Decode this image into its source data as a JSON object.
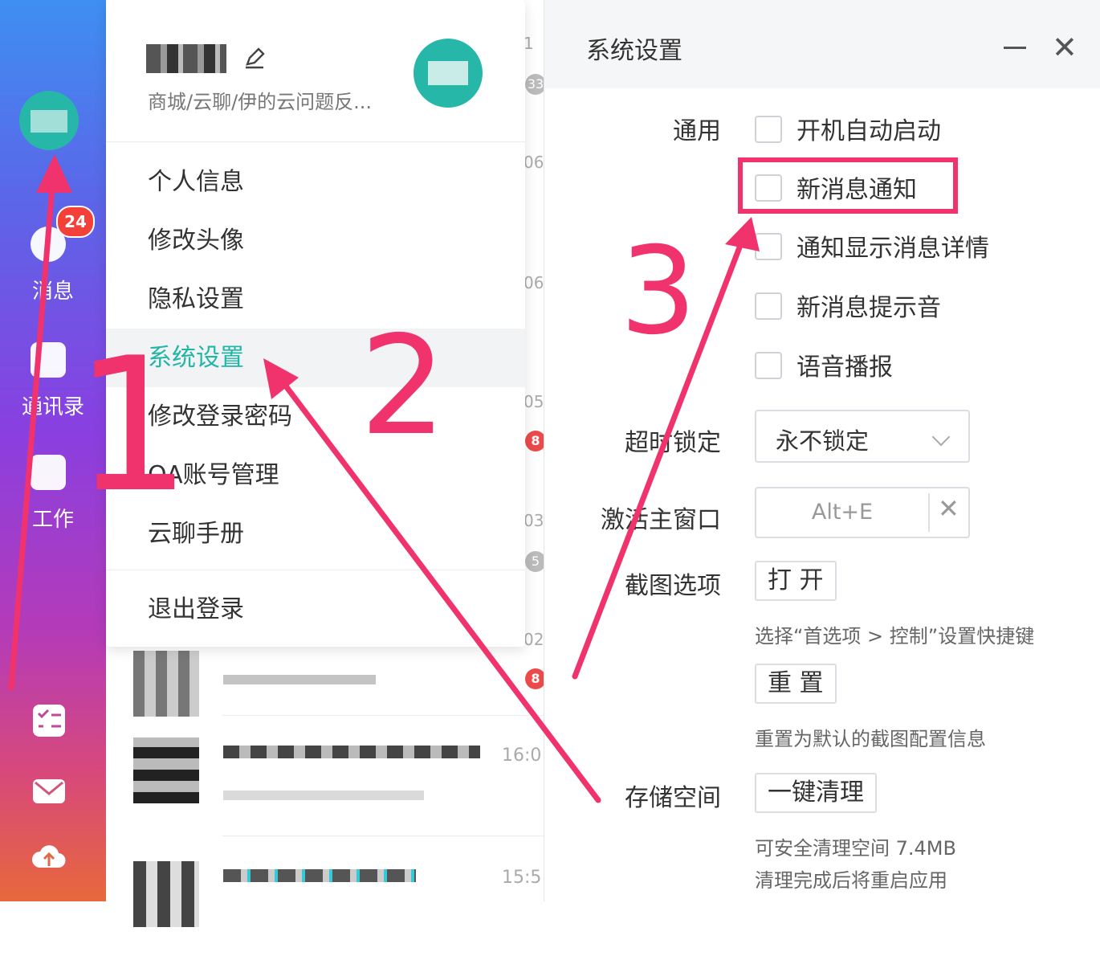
{
  "sidebar": {
    "badge": "24",
    "items": [
      {
        "label": "消息",
        "icon": "chat-bubble-icon"
      },
      {
        "label": "通讯录",
        "icon": "contacts-icon"
      },
      {
        "label": "工作",
        "icon": "work-box-icon"
      }
    ],
    "bottom_icons": [
      "task-list-icon",
      "mail-icon",
      "cloud-upload-icon"
    ]
  },
  "chat_list": {
    "times": [
      "16:0",
      "15:5"
    ],
    "fragments": [
      "1",
      "33",
      "06",
      "06",
      "05",
      "03",
      "02"
    ],
    "badges": [
      "8",
      "5",
      "8"
    ]
  },
  "profile_menu": {
    "subtitle": "商城/云聊/伊的云问题反...",
    "items": [
      "个人信息",
      "修改头像",
      "隐私设置",
      "系统设置",
      "修改登录密码",
      "OA账号管理",
      "云聊手册"
    ],
    "logout": "退出登录",
    "active_index": 3
  },
  "settings": {
    "title": "系统设置",
    "general_label": "通用",
    "checkboxes": [
      "开机自动启动",
      "新消息通知",
      "通知显示消息详情",
      "新消息提示音",
      "语音播报"
    ],
    "timeout_label": "超时锁定",
    "timeout_value": "永不锁定",
    "activate_label": "激活主窗口",
    "activate_value": "Alt+E",
    "screenshot_label": "截图选项",
    "open_button": "打 开",
    "open_hint": "选择“首选项 > 控制”设置快捷键",
    "reset_button": "重 置",
    "reset_hint": "重置为默认的截图配置信息",
    "storage_label": "存储空间",
    "clean_button": "一键清理",
    "storage_hint1": "可安全清理空间 7.4MB",
    "storage_hint2": "清理完成后将重启应用"
  },
  "annotations": {
    "step1": "1",
    "step2": "2",
    "step3": "3",
    "color": "#f0336d"
  },
  "colors": {
    "accent": "#21b6a7",
    "badge": "#f3413a"
  }
}
